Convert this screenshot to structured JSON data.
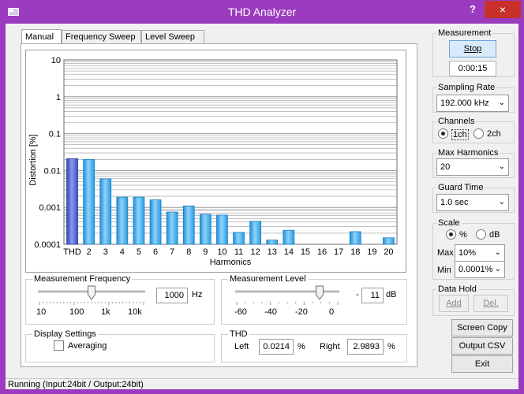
{
  "window": {
    "title": "THD Analyzer",
    "help": "?",
    "close": "×"
  },
  "tabs": [
    {
      "label": "Manual",
      "active": true
    },
    {
      "label": "Frequency Sweep",
      "active": false
    },
    {
      "label": "Level Sweep",
      "active": false
    }
  ],
  "chart_data": {
    "type": "bar",
    "xlabel": "Harmonics",
    "ylabel": "Distortion [%]",
    "yscale": "log",
    "ylim": [
      0.0001,
      10
    ],
    "yticks": [
      "10",
      "1",
      "0.1",
      "0.01",
      "0.001",
      "0.0001"
    ],
    "categories": [
      "THD",
      "2",
      "3",
      "4",
      "5",
      "6",
      "7",
      "8",
      "9",
      "10",
      "11",
      "12",
      "13",
      "14",
      "15",
      "16",
      "17",
      "18",
      "19",
      "20"
    ],
    "values": [
      0.021,
      0.02,
      0.006,
      0.0019,
      0.0019,
      0.0016,
      0.00075,
      0.0011,
      0.00065,
      0.00062,
      0.00021,
      0.00042,
      0.00013,
      0.00024,
      null,
      null,
      null,
      0.00022,
      null,
      0.00015
    ],
    "colors": {
      "thd": "#4e62cf",
      "harmonic": "#39a9e8",
      "grid": "#9a9a9a"
    },
    "grid": true
  },
  "measurement_frequency": {
    "title": "Measurement Frequency",
    "value": "1000",
    "unit": "Hz",
    "scale": [
      "10",
      "100",
      "1k",
      "10k"
    ],
    "slider_fraction": 0.5
  },
  "measurement_level": {
    "title": "Measurement Level",
    "sign": "-",
    "value": "11",
    "unit": "dB",
    "scale": [
      "-60",
      "-40",
      "-20",
      "0"
    ],
    "slider_fraction": 0.82
  },
  "display_settings": {
    "title": "Display Settings",
    "averaging_label": "Averaging",
    "averaging_checked": false
  },
  "thd": {
    "title": "THD",
    "left_label": "Left",
    "left_value": "0.0214",
    "right_label": "Right",
    "right_value": "2.9893",
    "unit": "%"
  },
  "measurement": {
    "title": "Measurement",
    "stop_label": "Stop",
    "elapsed": "0:00:15"
  },
  "sampling_rate": {
    "title": "Sampling Rate",
    "value": "192.000 kHz"
  },
  "channels": {
    "title": "Channels",
    "option1": "1ch",
    "option2": "2ch",
    "selected": "1ch"
  },
  "max_harmonics": {
    "title": "Max Harmonics",
    "value": "20"
  },
  "guard_time": {
    "title": "Guard Time",
    "value": "1.0 sec"
  },
  "scale": {
    "title": "Scale",
    "opt_percent": "%",
    "opt_db": "dB",
    "selected": "%",
    "max_label": "Max",
    "max_value": "10%",
    "min_label": "Min",
    "min_value": "0.0001%"
  },
  "data_hold": {
    "title": "Data Hold",
    "add_label": "Add",
    "del_label": "Del."
  },
  "buttons": {
    "screen_copy": "Screen Copy",
    "output_csv": "Output CSV",
    "exit": "Exit"
  },
  "status": "Running (Input:24bit / Output:24bit)"
}
